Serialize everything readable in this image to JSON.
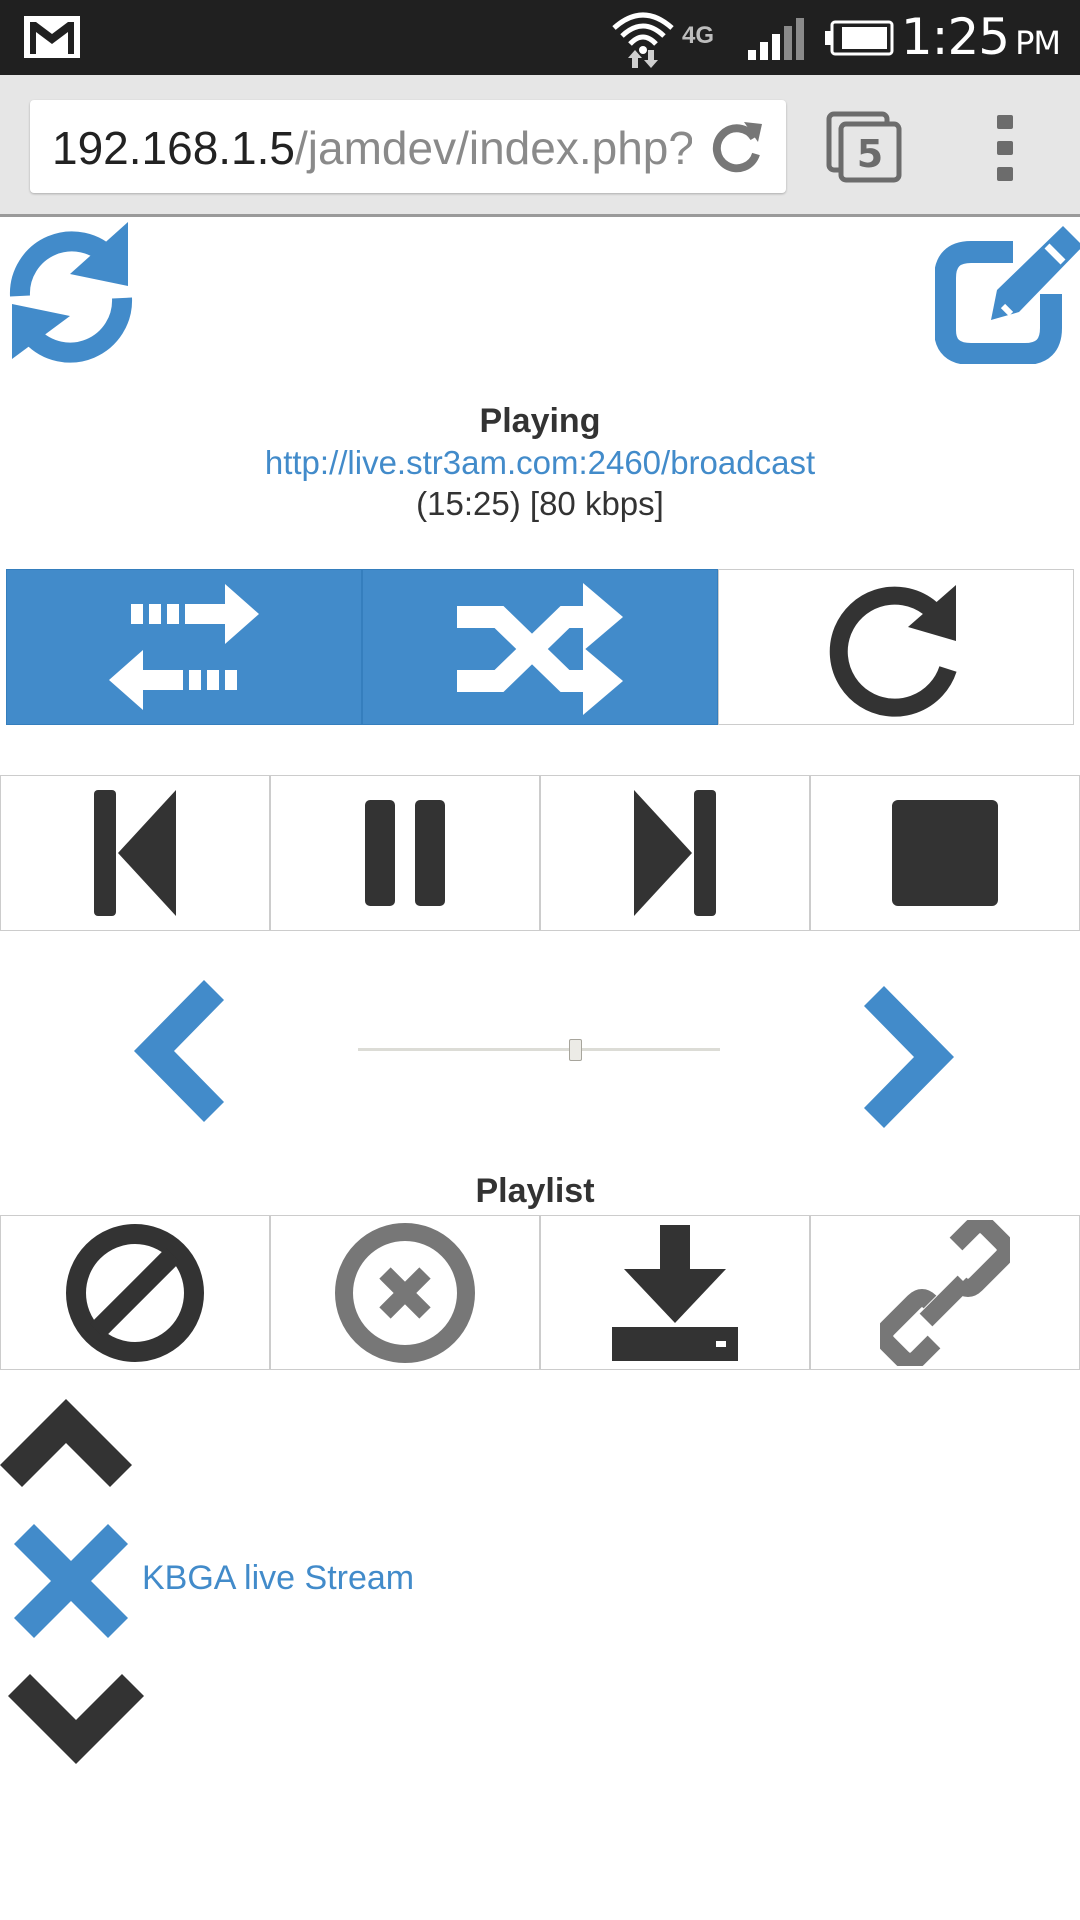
{
  "status_bar": {
    "time": "1:25",
    "ampm": "PM",
    "network": "4G"
  },
  "browser": {
    "url_host": "192.168.1.5",
    "url_path": "/jamdev/index.php?l",
    "tab_count": "5"
  },
  "now_playing": {
    "heading": "Playing",
    "stream_url": "http://live.str3am.com:2460/broadcast",
    "info": "(15:25) [80 kbps]"
  },
  "modes": {
    "repeat_active": true,
    "shuffle_active": true,
    "single_active": false
  },
  "volume": {
    "level_percent": 60
  },
  "playlist": {
    "heading": "Playlist",
    "items": [
      {
        "label": "KBGA live Stream"
      }
    ]
  },
  "colors": {
    "accent": "#428bca",
    "dark_icon": "#333333",
    "grey_icon": "#777777",
    "status_bar": "#202020"
  }
}
